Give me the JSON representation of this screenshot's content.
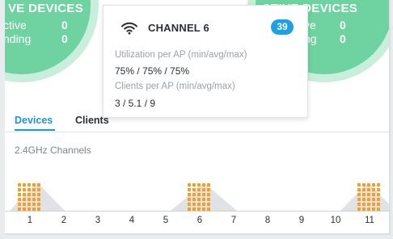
{
  "devices_left": {
    "title": "VE DEVICES",
    "rows": [
      {
        "label": "ctive",
        "value": "0"
      },
      {
        "label": "nding",
        "value": "0"
      }
    ]
  },
  "devices_right": {
    "title": "CTIVE DEVICES",
    "rows": [
      {
        "label": "ve",
        "value": "0"
      },
      {
        "label": "ng",
        "value": "0"
      }
    ]
  },
  "tooltip": {
    "title": "CHANNEL 6",
    "badge": "39",
    "utilization_label": "Utilization per AP (min/avg/max)",
    "utilization_value": "75% / 75% / 75%",
    "clients_label": "Clients per AP (min/avg/max)",
    "clients_value": "3 / 5.1 / 9"
  },
  "tabs": {
    "devices": "Devices",
    "clients": "Clients"
  },
  "section_label": "2.4GHz Channels",
  "channels": [
    "1",
    "2",
    "3",
    "4",
    "5",
    "6",
    "7",
    "8",
    "9",
    "10",
    "11"
  ],
  "channel_bars": [
    {
      "channel": "1",
      "cells": 30
    },
    {
      "channel": "6",
      "cells": 30
    },
    {
      "channel": "11",
      "cells": 30
    }
  ],
  "colors": {
    "accent": "#1a96dc",
    "device_green": "#6ed3a0",
    "bar_orange": "#f5a023",
    "badge_blue": "#1ea0e6"
  }
}
